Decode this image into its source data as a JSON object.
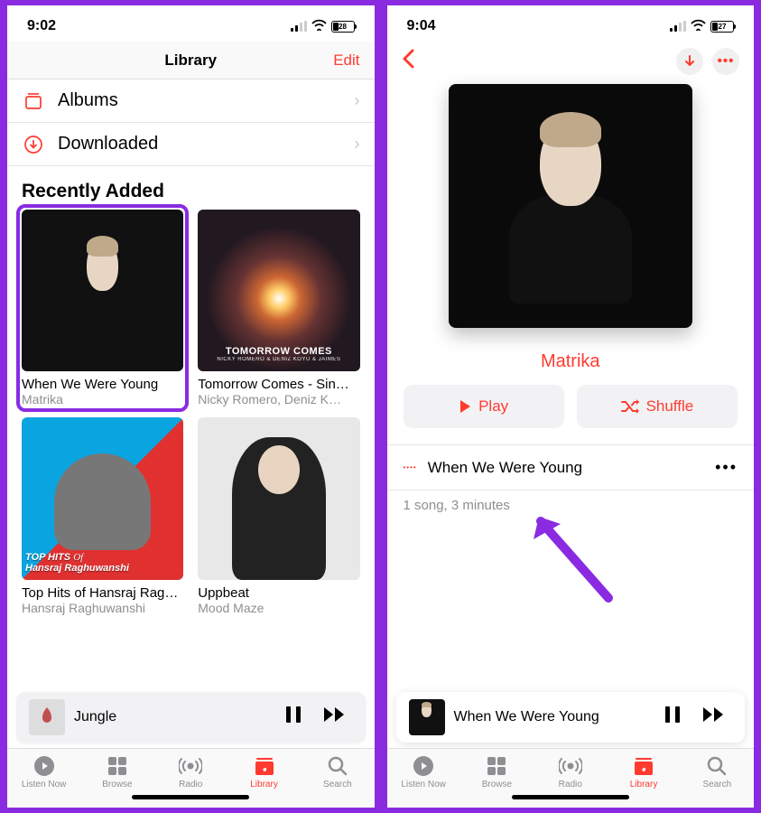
{
  "left": {
    "status": {
      "time": "9:02",
      "battery_pct": "28"
    },
    "nav": {
      "title": "Library",
      "edit": "Edit"
    },
    "rows": {
      "albums": "Albums",
      "downloaded": "Downloaded"
    },
    "section": "Recently Added",
    "cards": [
      {
        "title": "When We Were Young",
        "sub": "Matrika"
      },
      {
        "title": "Tomorrow Comes - Sin…",
        "sub": "Nicky Romero, Deniz K…",
        "art_text": "TOMORROW COMES",
        "art_sub": "NICKY ROMERO & DENIZ KOYU & JAIMES"
      },
      {
        "title": "Top Hits of Hansraj Rag…",
        "sub": "Hansraj Raghuwanshi",
        "art_text_a": "TOP HITS",
        "art_text_b": "Of",
        "art_text_c": "Hansraj Raghuwanshi"
      },
      {
        "title": "Uppbeat",
        "sub": "Mood Maze"
      }
    ],
    "mini": {
      "title": "Jungle"
    },
    "tabs": [
      "Listen Now",
      "Browse",
      "Radio",
      "Library",
      "Search"
    ]
  },
  "right": {
    "status": {
      "time": "9:04",
      "battery_pct": "27"
    },
    "artist": "Matrika",
    "play": "Play",
    "shuffle": "Shuffle",
    "song": "When We Were Young",
    "summary": "1 song, 3 minutes",
    "mini": {
      "title": "When We Were Young"
    },
    "tabs": [
      "Listen Now",
      "Browse",
      "Radio",
      "Library",
      "Search"
    ]
  }
}
